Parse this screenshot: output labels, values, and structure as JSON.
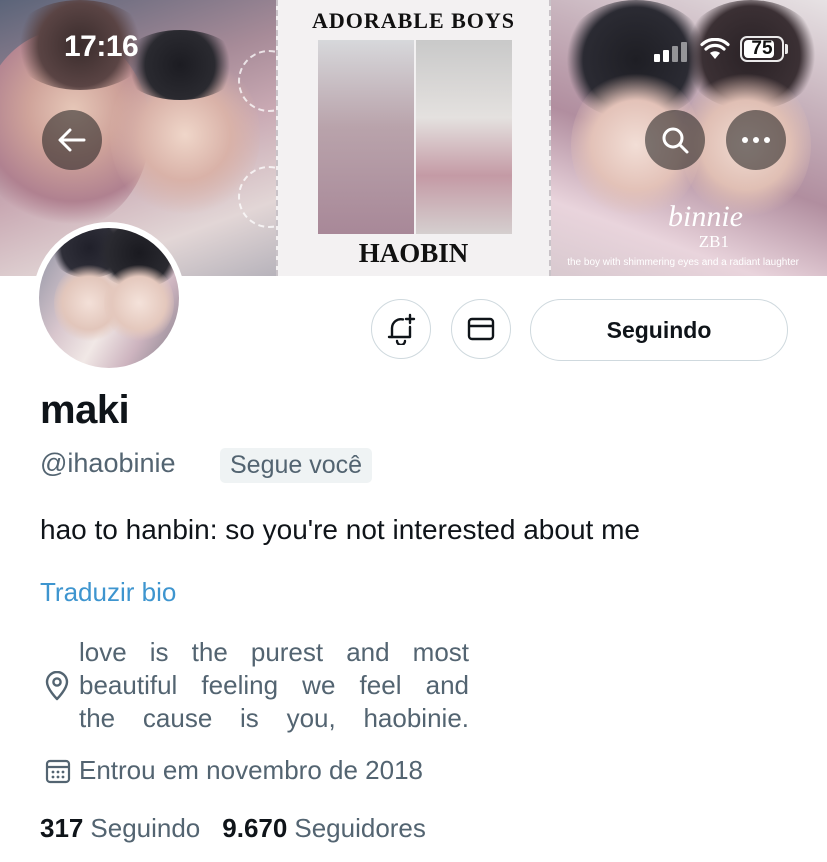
{
  "status_bar": {
    "time": "17:16",
    "battery": "75"
  },
  "banner": {
    "middle_title_top": "ADORABLE BOYS",
    "middle_title_bottom": "HAOBIN",
    "right_script": "binnie",
    "right_label": "ZB1",
    "right_tagline": "the boy with shimmering eyes and a radiant laughter"
  },
  "profile": {
    "display_name": "maki",
    "handle": "@ihaobinie",
    "follows_you_badge": "Segue você",
    "bio": "hao to hanbin: so you're not interested about me",
    "translate_link": "Traduzir bio",
    "location_lines": [
      "love is the purest and most",
      "beautiful feeling we feel and",
      "the cause is you, haobinie."
    ],
    "joined": "Entrou em novembro de 2018",
    "following_count": "317",
    "following_label": "Seguindo",
    "followers_count": "9.670",
    "followers_label": "Seguidores"
  },
  "actions": {
    "follow_state_label": "Seguindo"
  },
  "colors": {
    "accent": "#3e95cf",
    "secondary_text": "#536471",
    "border": "#cfd9de"
  },
  "icons": [
    "back-arrow-icon",
    "search-icon",
    "more-icon",
    "notification-bell-plus-icon",
    "mail-icon",
    "location-pin-icon",
    "calendar-icon",
    "signal-icon",
    "wifi-icon",
    "battery-icon"
  ]
}
